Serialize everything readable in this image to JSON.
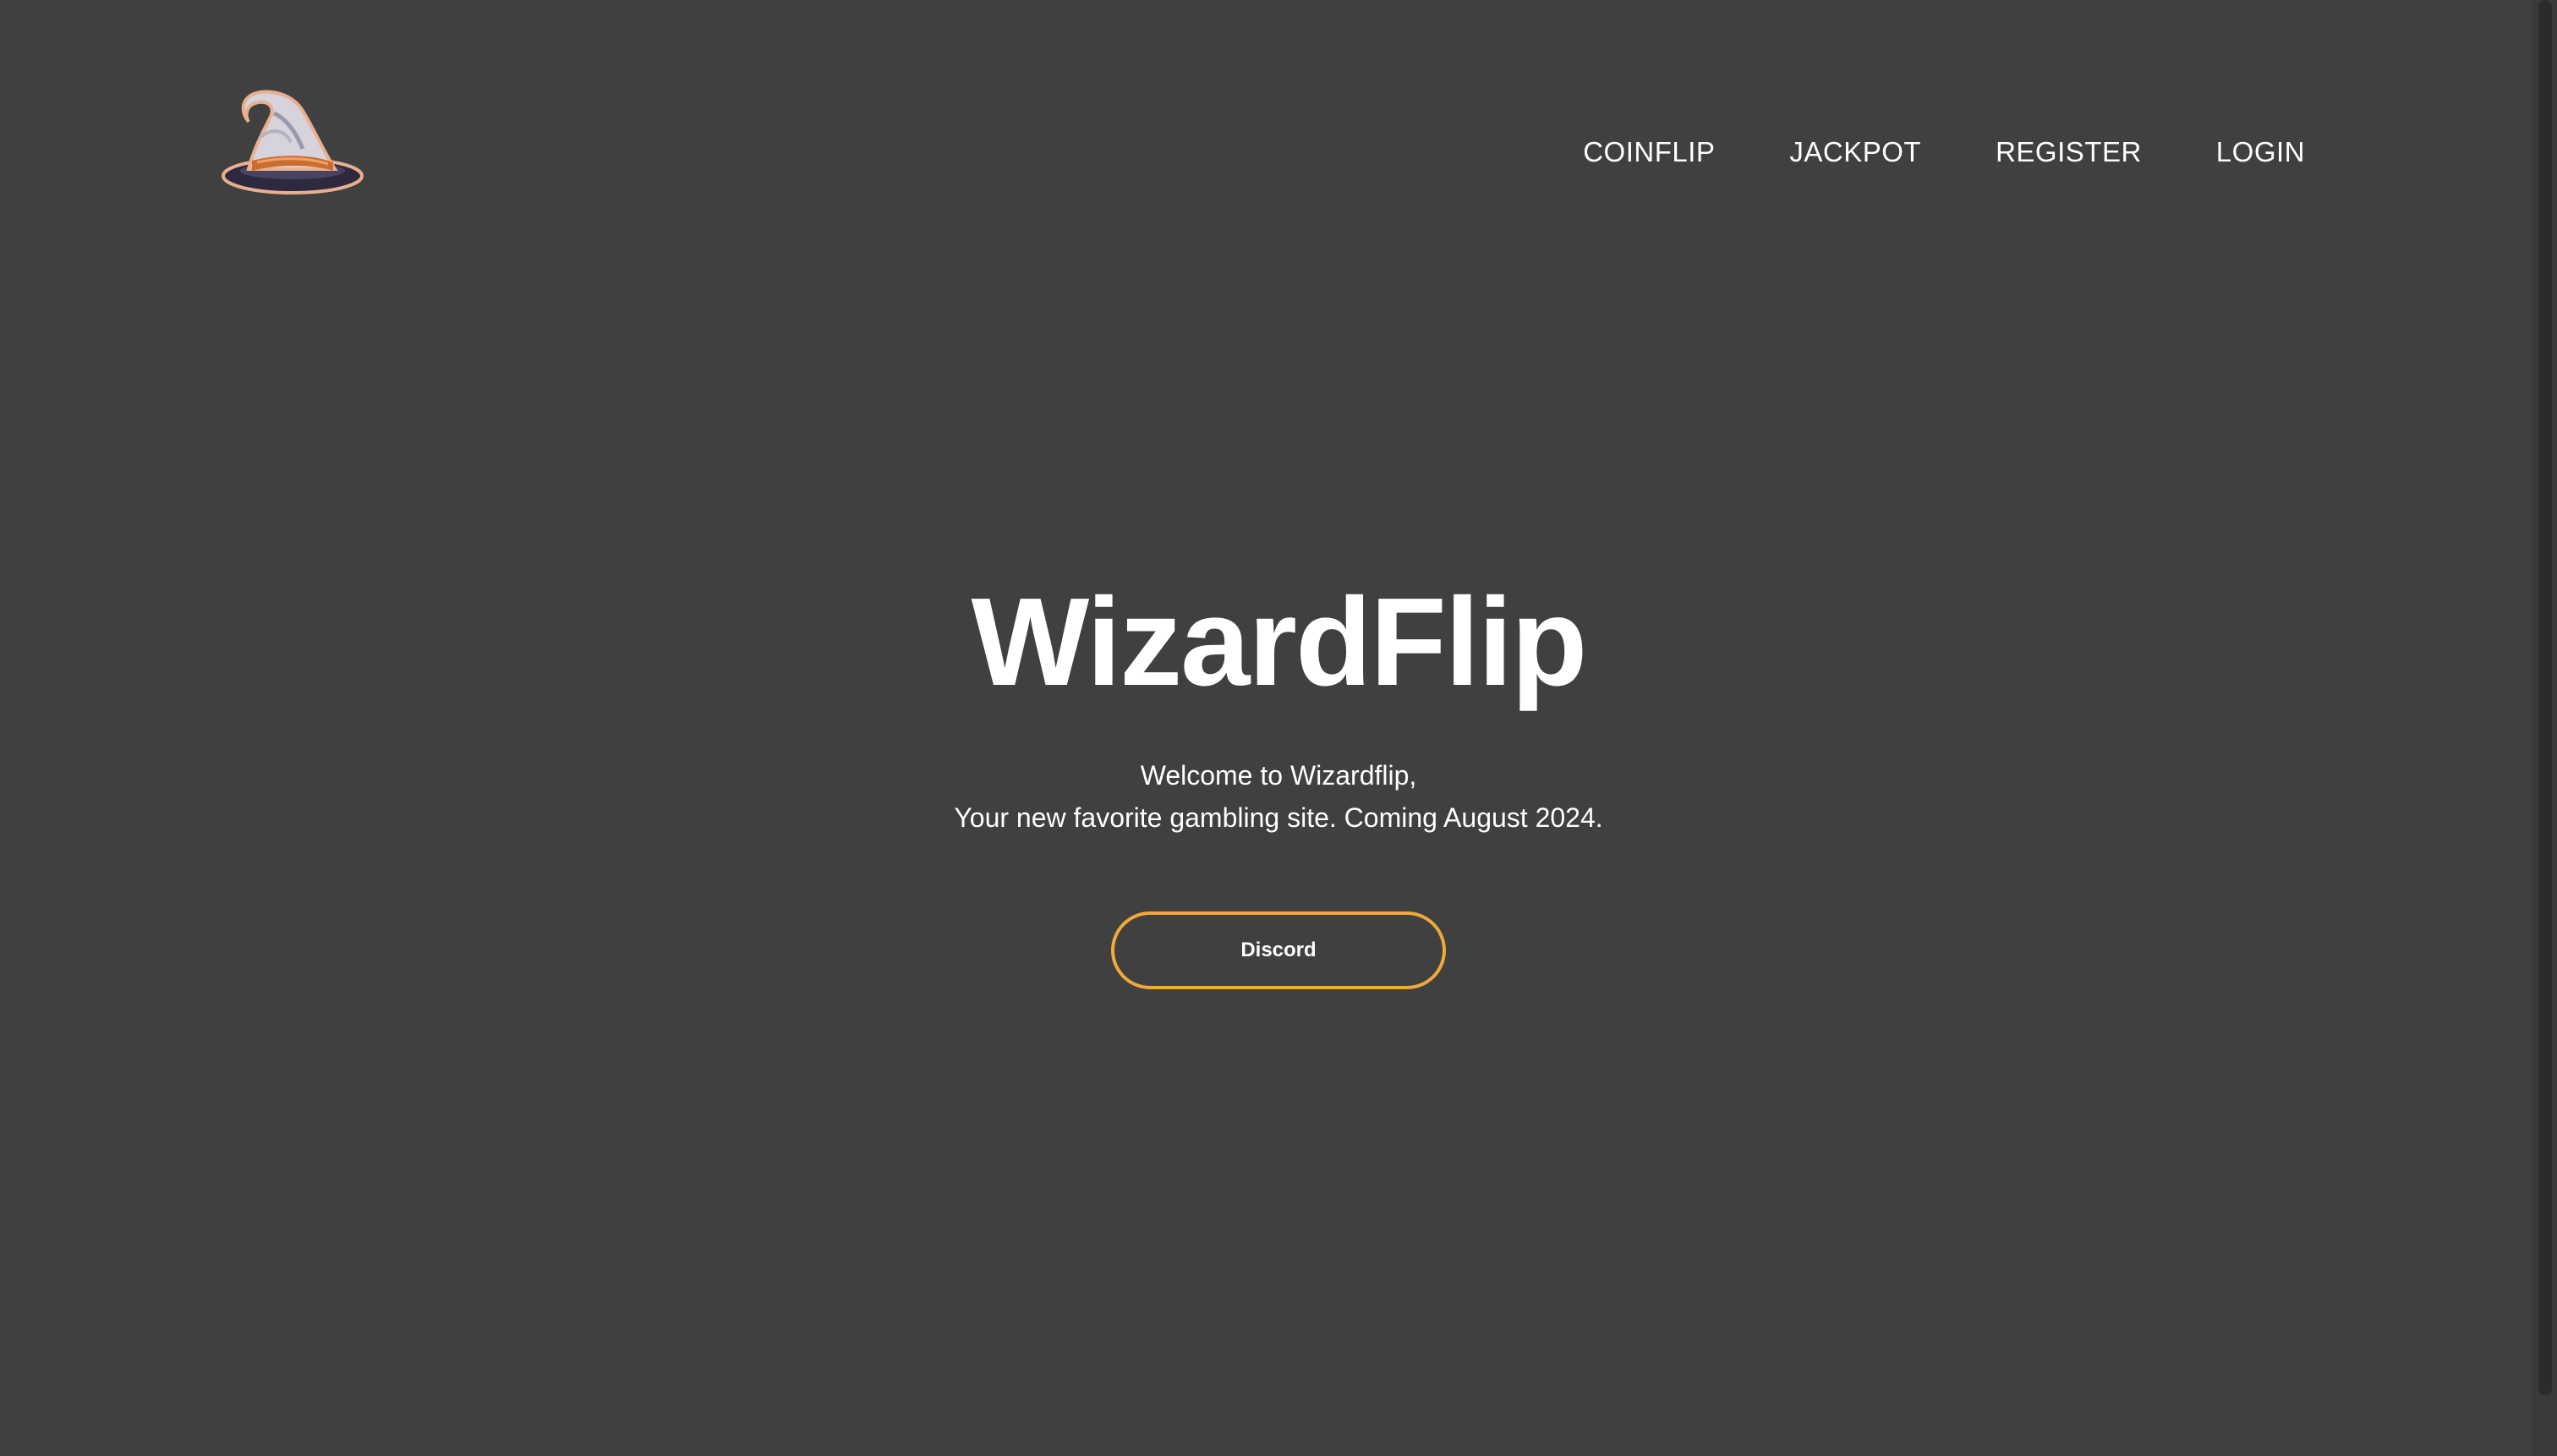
{
  "brand": {
    "logo_icon": "wizard-hat-icon"
  },
  "nav": {
    "items": [
      {
        "label": "COINFLIP"
      },
      {
        "label": "JACKPOT"
      },
      {
        "label": "REGISTER"
      },
      {
        "label": "LOGIN"
      }
    ]
  },
  "hero": {
    "title": "WizardFlip",
    "line1": "Welcome to Wizardflip,",
    "line2": "Your new favorite gambling site. Coming August 2024.",
    "button_label": "Discord"
  },
  "colors": {
    "background": "#404040",
    "text": "#ffffff",
    "accent": "#f0a93a"
  }
}
